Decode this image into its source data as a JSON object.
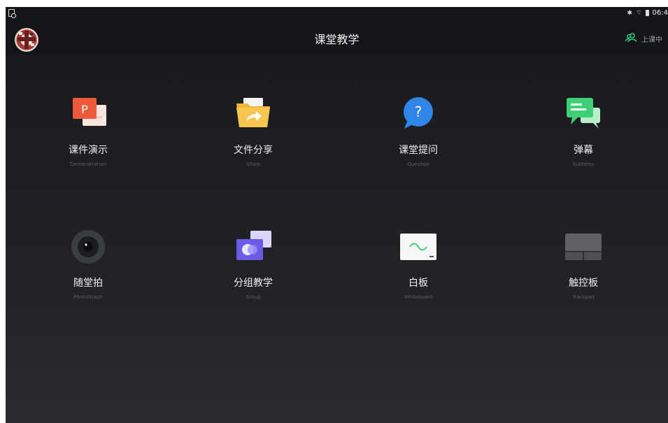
{
  "status_bar": {
    "time": "06:4",
    "icons": [
      "notification-icon",
      "bluetooth-icon",
      "wifi-icon",
      "battery-icon"
    ]
  },
  "header": {
    "title": "课堂教学",
    "class_state": "上课中",
    "class_state_icon": "group-users-icon",
    "accent_color": "#2fd18a"
  },
  "features": [
    {
      "label": "课件演示",
      "sub": "Demonstration",
      "icon": "ppt-icon"
    },
    {
      "label": "文件分享",
      "sub": "Share",
      "icon": "folder-share-icon"
    },
    {
      "label": "课堂提问",
      "sub": "Question",
      "icon": "question-icon"
    },
    {
      "label": "弹幕",
      "sub": "Subtitles",
      "icon": "chat-bubbles-icon"
    },
    {
      "label": "随堂拍",
      "sub": "PhotoGraph",
      "icon": "camera-icon"
    },
    {
      "label": "分组教学",
      "sub": "Group",
      "icon": "group-cards-icon"
    },
    {
      "label": "白板",
      "sub": "Whiteboard",
      "icon": "whiteboard-icon"
    },
    {
      "label": "触控板",
      "sub": "Trackpad",
      "icon": "trackpad-icon"
    }
  ]
}
